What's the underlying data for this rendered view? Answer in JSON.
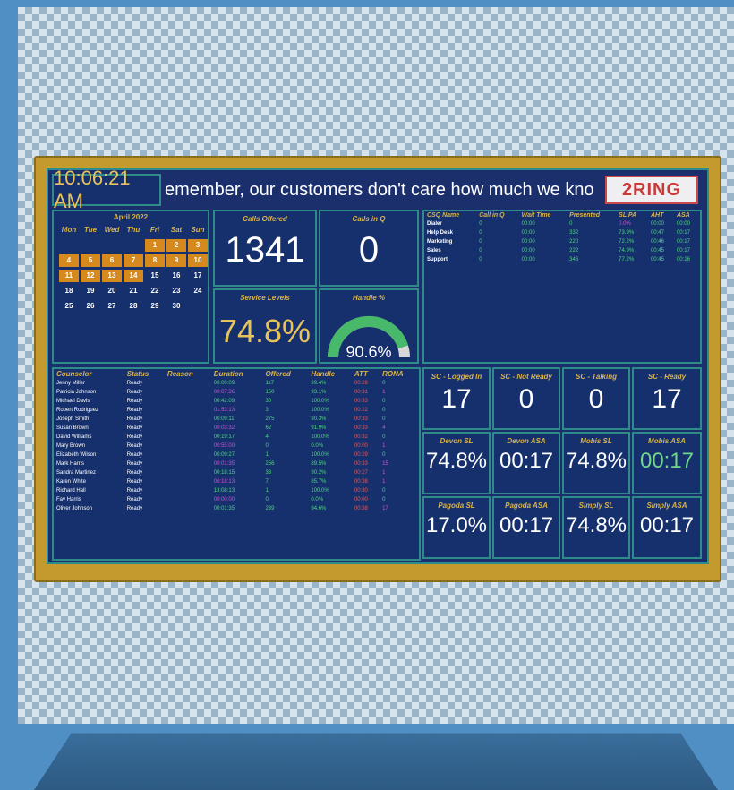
{
  "clock": "10:06:21 AM",
  "ticker": "emember, our customers don't care how much we kno",
  "logo": "2RING",
  "calendar": {
    "title": "April 2022",
    "dow": [
      "Mon",
      "Tue",
      "Wed",
      "Thu",
      "Fri",
      "Sat",
      "Sun"
    ],
    "weeks": [
      [
        "",
        "",
        "",
        "",
        "1",
        "2",
        "3"
      ],
      [
        "4",
        "5",
        "6",
        "7",
        "8",
        "9",
        "10"
      ],
      [
        "11",
        "12",
        "13",
        "14",
        "15",
        "16",
        "17"
      ],
      [
        "18",
        "19",
        "20",
        "21",
        "22",
        "23",
        "24"
      ],
      [
        "25",
        "26",
        "27",
        "28",
        "29",
        "30",
        ""
      ]
    ],
    "highlight_until": 14
  },
  "calls_offered": {
    "title": "Calls Offered",
    "value": "1341"
  },
  "calls_in_q": {
    "title": "Calls in Q",
    "value": "0"
  },
  "service_levels": {
    "title": "Service Levels",
    "value": "74.8%"
  },
  "handle": {
    "title": "Handle %",
    "value": "90.6%",
    "fraction": 0.906
  },
  "queues": {
    "headers": [
      "CSQ Name",
      "Call in Q",
      "Wait Time",
      "Presented",
      "SL PA",
      "AHT",
      "ASA"
    ],
    "rows": [
      [
        "Dialer",
        "0",
        "00:00",
        "0",
        "0.0%",
        "00:00",
        "00:00"
      ],
      [
        "Help Desk",
        "0",
        "00:00",
        "332",
        "73.9%",
        "00:47",
        "00:17"
      ],
      [
        "Marketing",
        "0",
        "00:00",
        "220",
        "72.2%",
        "00:46",
        "00:17"
      ],
      [
        "Sales",
        "0",
        "00:00",
        "222",
        "74.9%",
        "00:45",
        "00:17"
      ],
      [
        "Support",
        "0",
        "00:00",
        "346",
        "77.2%",
        "00:45",
        "00:16"
      ]
    ]
  },
  "agents": {
    "headers": [
      "Counselor",
      "Status",
      "Reason",
      "Duration",
      "Offered",
      "Handle",
      "ATT",
      "RONA"
    ],
    "rows": [
      [
        "Jenny Miller",
        "Ready",
        "",
        "00:00:09",
        "117",
        "99.4%",
        "00:28",
        "0"
      ],
      [
        "Patricia Johnson",
        "Ready",
        "",
        "00:07:36",
        "150",
        "93.1%",
        "00:31",
        "1"
      ],
      [
        "Michael Davis",
        "Ready",
        "",
        "00:42:09",
        "30",
        "100.0%",
        "00:33",
        "0"
      ],
      [
        "Robert Rodriguez",
        "Ready",
        "",
        "01:53:13",
        "3",
        "100.0%",
        "00:22",
        "0"
      ],
      [
        "Joseph Smith",
        "Ready",
        "",
        "00:09:11",
        "275",
        "90.3%",
        "00:33",
        "0"
      ],
      [
        "Susan Brown",
        "Ready",
        "",
        "00:03:32",
        "62",
        "91.9%",
        "00:33",
        "4"
      ],
      [
        "David Williams",
        "Ready",
        "",
        "00:19:17",
        "4",
        "100.0%",
        "00:32",
        "0"
      ],
      [
        "Mary Brown",
        "Ready",
        "",
        "00:55:00",
        "0",
        "0.0%",
        "00:00",
        "1"
      ],
      [
        "Elizabeth Wilson",
        "Ready",
        "",
        "00:09:27",
        "1",
        "100.0%",
        "00:29",
        "0"
      ],
      [
        "Mark Harris",
        "Ready",
        "",
        "00:01:35",
        "256",
        "89.5%",
        "00:33",
        "15"
      ],
      [
        "Sandra Martinez",
        "Ready",
        "",
        "00:18:15",
        "38",
        "90.2%",
        "00:27",
        "1"
      ],
      [
        "Karen White",
        "Ready",
        "",
        "00:18:13",
        "7",
        "85.7%",
        "00:38",
        "1"
      ],
      [
        "Richard Hall",
        "Ready",
        "",
        "13:08:13",
        "1",
        "100.0%",
        "00:30",
        "0"
      ],
      [
        "Fay Harris",
        "Ready",
        "",
        "00:00:00",
        "0",
        "0.0%",
        "00:00",
        "0"
      ],
      [
        "Oliver Johnson",
        "Ready",
        "",
        "00:01:35",
        "239",
        "94.6%",
        "00:38",
        "17"
      ]
    ]
  },
  "tiles": [
    {
      "title": "SC - Logged In",
      "value": "17",
      "color": "#ffffff"
    },
    {
      "title": "SC - Not Ready",
      "value": "0",
      "color": "#ffffff"
    },
    {
      "title": "SC - Talking",
      "value": "0",
      "color": "#ffffff"
    },
    {
      "title": "SC - Ready",
      "value": "17",
      "color": "#ffffff"
    },
    {
      "title": "Devon SL",
      "value": "74.8%",
      "color": "#ffffff"
    },
    {
      "title": "Devon ASA",
      "value": "00:17",
      "color": "#ffffff"
    },
    {
      "title": "Mobis SL",
      "value": "74.8%",
      "color": "#ffffff"
    },
    {
      "title": "Mobis ASA",
      "value": "00:17",
      "color": "#6fd68a"
    },
    {
      "title": "Pagoda SL",
      "value": "17.0%",
      "color": "#ffffff"
    },
    {
      "title": "Pagoda ASA",
      "value": "00:17",
      "color": "#ffffff"
    },
    {
      "title": "Simply SL",
      "value": "74.8%",
      "color": "#ffffff"
    },
    {
      "title": "Simply ASA",
      "value": "00:17",
      "color": "#ffffff"
    }
  ]
}
